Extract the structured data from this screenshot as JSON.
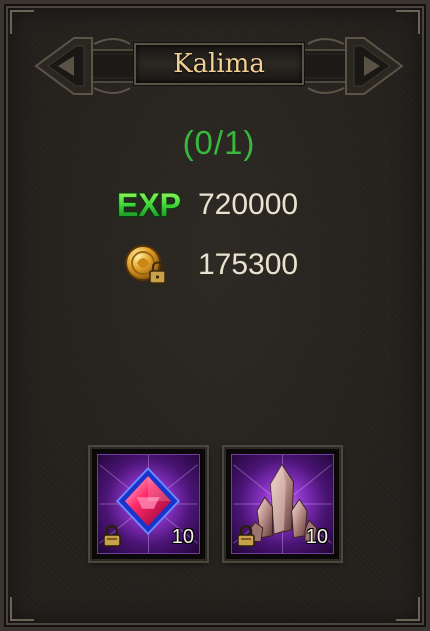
{
  "header": {
    "title": "Kalima"
  },
  "quest": {
    "progress": "(0/1)"
  },
  "rewards": {
    "exp": {
      "icon": "exp-icon",
      "label": "EXP",
      "value": "720000"
    },
    "gold": {
      "icon": "bound-gold-coin-icon",
      "value": "175300"
    }
  },
  "items": [
    {
      "name": "red-jewel-icon",
      "quantity": "10",
      "locked": true
    },
    {
      "name": "crystal-shard-icon",
      "quantity": "10",
      "locked": true
    }
  ],
  "colors": {
    "title": "#f2cf95",
    "progress": "#38b83c",
    "value": "#e9e2cf",
    "item_bg": "#8b33c8"
  }
}
